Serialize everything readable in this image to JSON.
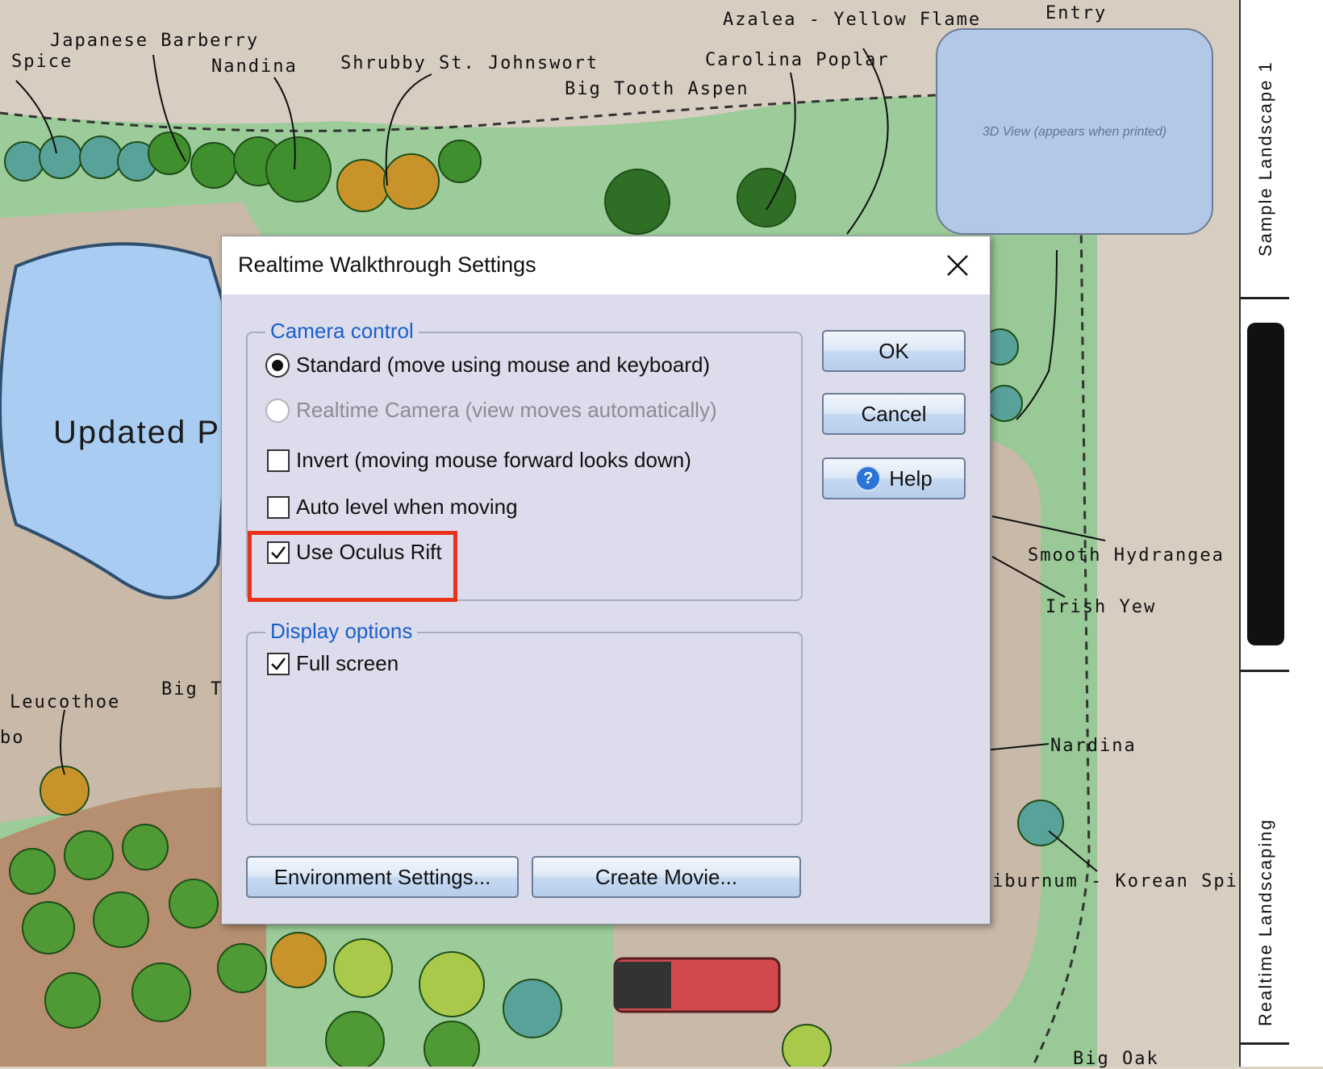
{
  "plan": {
    "labels": {
      "japanese_barberry": "Japanese Barberry",
      "spice_top": "Spice",
      "nandina_top": "Nandina",
      "shrubby": "Shrubby St. Johnswort",
      "azalea": "Azalea - Yellow Flame",
      "entry": "Entry",
      "carolina": "Carolina Poplar",
      "aspen": "Big Tooth Aspen",
      "hydrangea": "Smooth Hydrangea",
      "yew": "Irish Yew",
      "nandina_right": "Nardina",
      "viburnum": "iburnum - Korean Spice",
      "leucothoe": "Leucothoe",
      "big_t": "Big T",
      "bo": "bo",
      "bottom_right": "Big Oak"
    },
    "pool_text": "Updated P",
    "view3d_label": "3D View (appears when printed)"
  },
  "side_panel": {
    "label_top": "Sample Landscape 1",
    "label_bottom": "Realtime Landscaping"
  },
  "dialog": {
    "title": "Realtime Walkthrough Settings",
    "camera_group": "Camera control",
    "standard": "Standard (move using mouse and keyboard)",
    "realtime_camera": "Realtime Camera (view moves automatically)",
    "invert": "Invert (moving mouse forward looks down)",
    "auto_level": "Auto level when moving",
    "oculus": "Use Oculus Rift",
    "display_group": "Display options",
    "full_screen": "Full screen",
    "ok": "OK",
    "cancel": "Cancel",
    "help": "Help",
    "environment": "Environment Settings...",
    "create_movie": "Create Movie..."
  },
  "state": {
    "standard_selected": true,
    "invert_checked": false,
    "auto_level_checked": false,
    "oculus_checked": true,
    "full_screen_checked": true
  },
  "colors": {
    "lawn": "#9ccc9a",
    "deck": "#c9b9a8",
    "pool_water": "#a9cdf2",
    "group_legend": "#1b5fcc",
    "highlight": "#e8321c"
  }
}
